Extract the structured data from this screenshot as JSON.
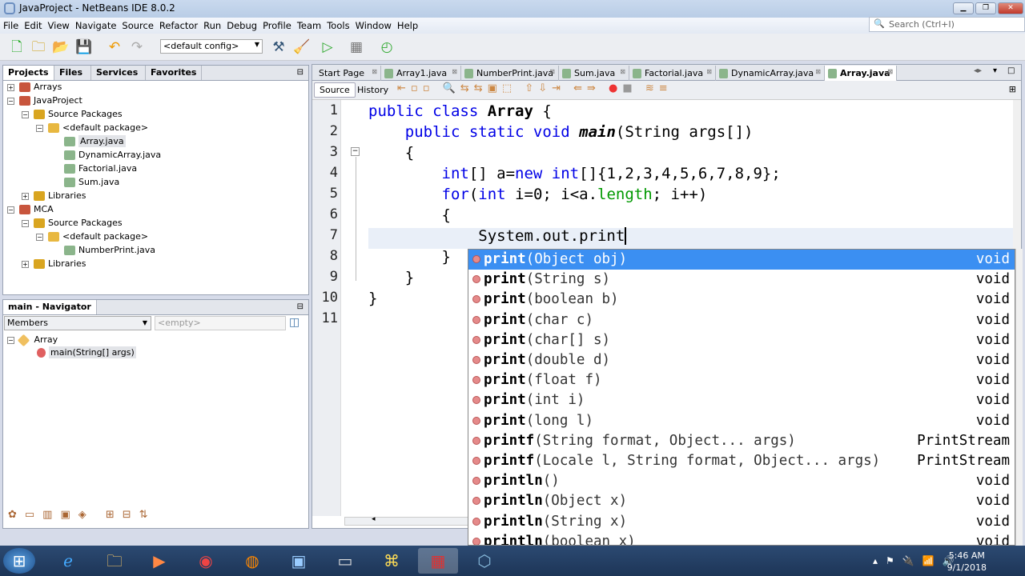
{
  "window": {
    "title": "JavaProject - NetBeans IDE 8.0.2"
  },
  "menu": [
    "File",
    "Edit",
    "View",
    "Navigate",
    "Source",
    "Refactor",
    "Run",
    "Debug",
    "Profile",
    "Team",
    "Tools",
    "Window",
    "Help"
  ],
  "search": {
    "placeholder": "Search (Ctrl+I)"
  },
  "toolbar": {
    "config": "<default config>"
  },
  "projects_panel": {
    "tabs": [
      "Projects",
      "Files",
      "Services",
      "Favorites"
    ],
    "tree": [
      {
        "label": "Arrays",
        "depth": 0,
        "type": "project",
        "toggle": "+"
      },
      {
        "label": "JavaProject",
        "depth": 0,
        "type": "project",
        "toggle": "-"
      },
      {
        "label": "Source Packages",
        "depth": 1,
        "type": "folder",
        "toggle": "-"
      },
      {
        "label": "<default package>",
        "depth": 2,
        "type": "package",
        "toggle": "-"
      },
      {
        "label": "Array.java",
        "depth": 3,
        "type": "file",
        "selected": true
      },
      {
        "label": "DynamicArray.java",
        "depth": 3,
        "type": "file"
      },
      {
        "label": "Factorial.java",
        "depth": 3,
        "type": "file"
      },
      {
        "label": "Sum.java",
        "depth": 3,
        "type": "file"
      },
      {
        "label": "Libraries",
        "depth": 1,
        "type": "folder",
        "toggle": "+"
      },
      {
        "label": "MCA",
        "depth": 0,
        "type": "project",
        "toggle": "-"
      },
      {
        "label": "Source Packages",
        "depth": 1,
        "type": "folder",
        "toggle": "-"
      },
      {
        "label": "<default package>",
        "depth": 2,
        "type": "package",
        "toggle": "-"
      },
      {
        "label": "NumberPrint.java",
        "depth": 3,
        "type": "file"
      },
      {
        "label": "Libraries",
        "depth": 1,
        "type": "folder",
        "toggle": "+"
      }
    ]
  },
  "navigator": {
    "title": "main - Navigator",
    "filter": "Members",
    "secondary": "<empty>",
    "class_name": "Array",
    "method": "main(String[] args)"
  },
  "editor": {
    "tabs": [
      "Start Page",
      "Array1.java",
      "NumberPrint.java",
      "Sum.java",
      "Factorial.java",
      "DynamicArray.java",
      "Array.java"
    ],
    "active_tab": "Array.java",
    "view_tabs": [
      "Source",
      "History"
    ],
    "line_numbers": [
      "1",
      "2",
      "3",
      "4",
      "5",
      "6",
      "7",
      "8",
      "9",
      "10",
      "11"
    ]
  },
  "completion": [
    {
      "name": "print",
      "params": "(Object obj)",
      "ret": "void",
      "selected": true
    },
    {
      "name": "print",
      "params": "(String s)",
      "ret": "void"
    },
    {
      "name": "print",
      "params": "(boolean b)",
      "ret": "void"
    },
    {
      "name": "print",
      "params": "(char c)",
      "ret": "void"
    },
    {
      "name": "print",
      "params": "(char[] s)",
      "ret": "void"
    },
    {
      "name": "print",
      "params": "(double d)",
      "ret": "void"
    },
    {
      "name": "print",
      "params": "(float f)",
      "ret": "void"
    },
    {
      "name": "print",
      "params": "(int i)",
      "ret": "void"
    },
    {
      "name": "print",
      "params": "(long l)",
      "ret": "void"
    },
    {
      "name": "printf",
      "params": "(String format, Object... args)",
      "ret": "PrintStream"
    },
    {
      "name": "printf",
      "params": "(Locale l, String format, Object... args)",
      "ret": "PrintStream"
    },
    {
      "name": "println",
      "params": "()",
      "ret": "void"
    },
    {
      "name": "println",
      "params": "(Object x)",
      "ret": "void"
    },
    {
      "name": "println",
      "params": "(String x)",
      "ret": "void"
    },
    {
      "name": "println",
      "params": "(boolean x)",
      "ret": "void"
    }
  ],
  "clock": {
    "time": "5:46 AM",
    "date": "9/1/2018"
  }
}
